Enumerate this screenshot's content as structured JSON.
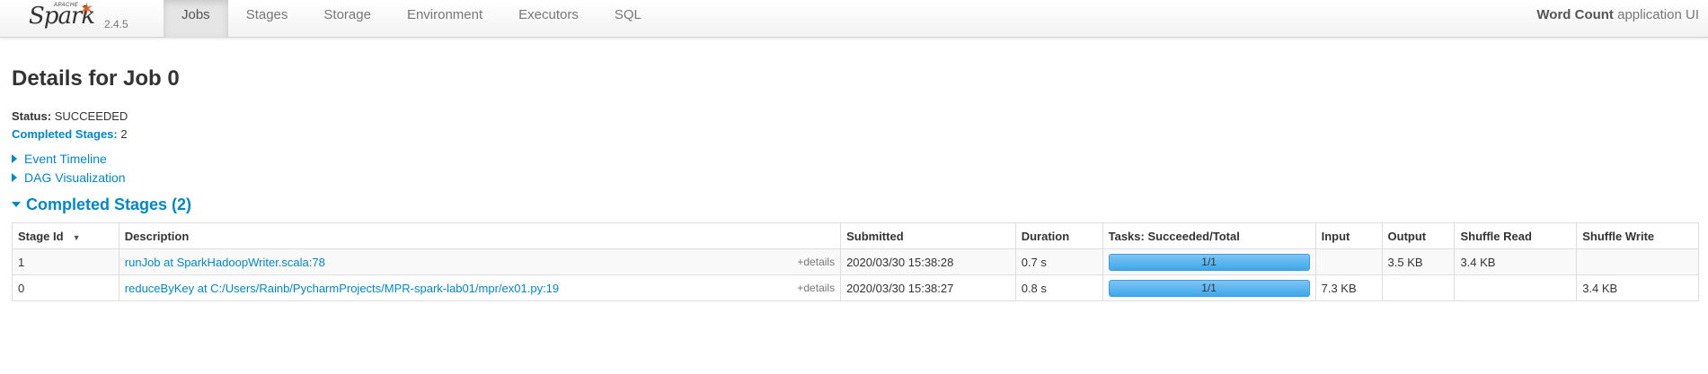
{
  "brand": {
    "apache": "APACHE",
    "name": "Spark",
    "version": "2.4.5"
  },
  "nav": {
    "tabs": [
      {
        "label": "Jobs",
        "active": true
      },
      {
        "label": "Stages"
      },
      {
        "label": "Storage"
      },
      {
        "label": "Environment"
      },
      {
        "label": "Executors"
      },
      {
        "label": "SQL"
      }
    ]
  },
  "app": {
    "name": "Word Count",
    "suffix": " application UI"
  },
  "page": {
    "title": "Details for Job 0",
    "status_label": "Status:",
    "status_value": "SUCCEEDED",
    "completed_label": "Completed Stages:",
    "completed_value": "2",
    "event_timeline": "Event Timeline",
    "dag_visualization": "DAG Visualization",
    "stages_header": "Completed Stages (2)"
  },
  "table": {
    "headers": [
      "Stage Id",
      "Description",
      "Submitted",
      "Duration",
      "Tasks: Succeeded/Total",
      "Input",
      "Output",
      "Shuffle Read",
      "Shuffle Write"
    ],
    "sort_glyph": "▼",
    "details_label": "+details",
    "rows": [
      {
        "stage_id": "1",
        "description": "runJob at SparkHadoopWriter.scala:78",
        "submitted": "2020/03/30 15:38:28",
        "duration": "0.7 s",
        "tasks": "1/1",
        "tasks_fraction": 1.0,
        "input": "",
        "output": "3.5 KB",
        "shuffle_read": "3.4 KB",
        "shuffle_write": ""
      },
      {
        "stage_id": "0",
        "description": "reduceByKey at C:/Users/Rainb/PycharmProjects/MPR-spark-lab01/mpr/ex01.py:19",
        "submitted": "2020/03/30 15:38:27",
        "duration": "0.8 s",
        "tasks": "1/1",
        "tasks_fraction": 1.0,
        "input": "7.3 KB",
        "output": "",
        "shuffle_read": "",
        "shuffle_write": "3.4 KB"
      }
    ]
  },
  "colors": {
    "link": "#0088cc",
    "progress": "#3ea8ea",
    "spark_orange": "#e25a1c"
  }
}
